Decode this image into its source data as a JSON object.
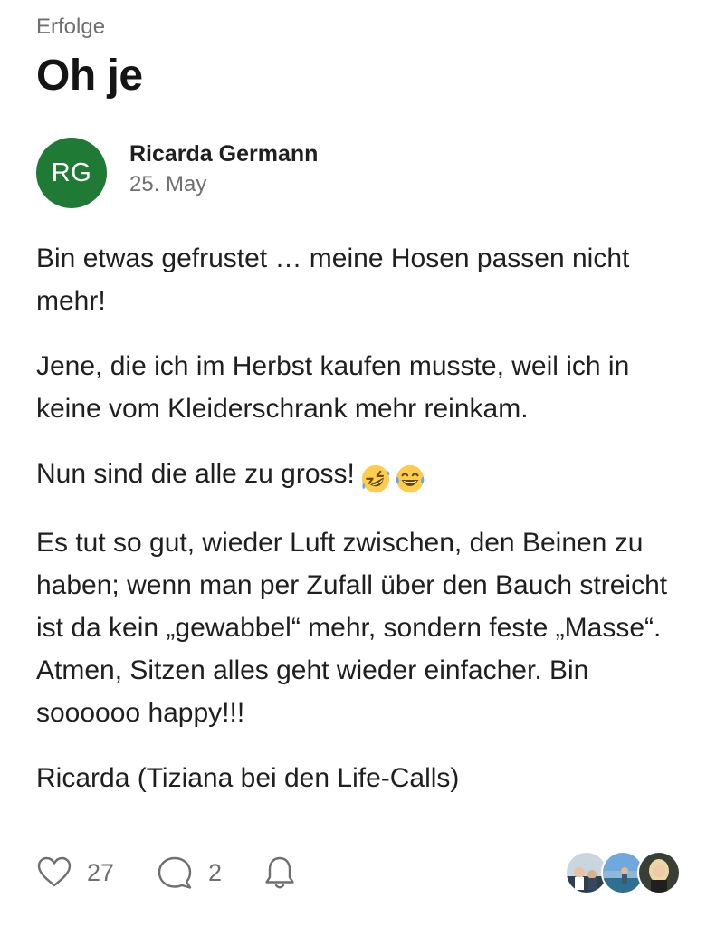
{
  "post": {
    "category": "Erfolge",
    "title": "Oh je",
    "author": {
      "initials": "RG",
      "name": "Ricarda Germann",
      "date": "25. May",
      "avatar_color": "#1e7a35"
    },
    "paragraphs": [
      "Bin etwas gefrustet … meine Hosen passen nicht mehr!",
      "Jene, die ich im Herbst kaufen musste, weil ich in keine vom Kleiderschrank mehr reinkam.",
      "Nun sind die alle zu gross!",
      "Es tut so gut, wieder Luft zwischen, den Beinen zu haben; wenn man per Zufall über den Bauch streicht ist da kein „gewabbel“ mehr, sondern feste „Masse“. Atmen, Sitzen alles geht wieder einfacher. Bin soooooo happy!!!",
      "Ricarda (Tiziana bei den Life-Calls)"
    ],
    "emojis": [
      "rolling-on-floor-laughing-emoji",
      "tears-of-joy-emoji"
    ]
  },
  "footer": {
    "likes": "27",
    "comments": "2",
    "icons": [
      "heart-icon",
      "comment-icon",
      "bell-icon"
    ],
    "participant_avatars": 3
  }
}
